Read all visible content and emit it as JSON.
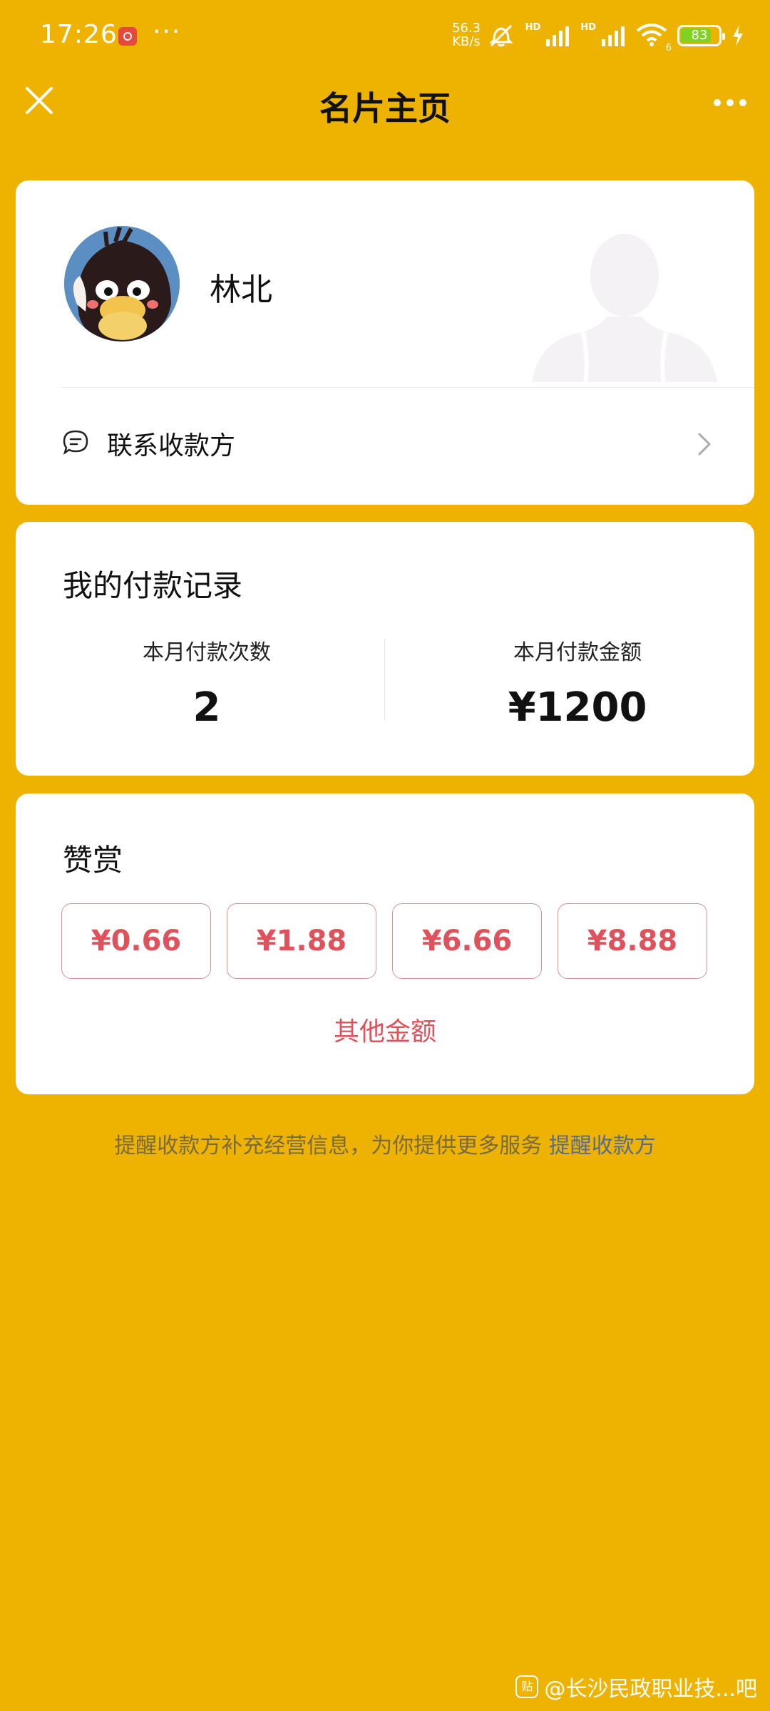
{
  "status_bar": {
    "time": "17:26",
    "dots": "···",
    "net_speed_value": "56.3",
    "net_speed_unit": "KB/s",
    "hd_1": "HD",
    "hd_2": "HD",
    "wifi_label": "6",
    "battery": "83",
    "battery_level": 0.83
  },
  "nav": {
    "title": "名片主页"
  },
  "profile": {
    "name": "林北",
    "contact_label": "联系收款方"
  },
  "records": {
    "title": "我的付款记录",
    "stats": [
      {
        "label": "本月付款次数",
        "value": "2"
      },
      {
        "label": "本月付款金额",
        "value": "¥1200"
      }
    ]
  },
  "reward": {
    "title": "赞赏",
    "amounts": [
      "¥0.66",
      "¥1.88",
      "¥6.66",
      "¥8.88"
    ],
    "other": "其他金额"
  },
  "footer": {
    "hint": "提醒收款方补充经营信息，为你提供更多服务",
    "link": "提醒收款方"
  },
  "watermark": {
    "logo_text": "贴",
    "text": "@长沙民政职业技...吧"
  },
  "colors": {
    "background": "#EDB300",
    "accent_red": "#E0525B",
    "link_blue": "#576B95"
  }
}
